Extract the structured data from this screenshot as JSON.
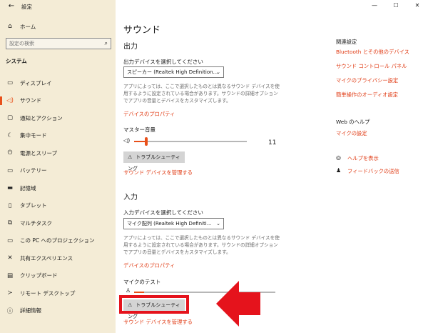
{
  "window": {
    "title": "設定",
    "controls": [
      "—",
      "☐",
      "✕"
    ]
  },
  "sidebar": {
    "home_label": "ホーム",
    "search_placeholder": "設定の検索",
    "section_label": "システム",
    "items": [
      {
        "label": "ディスプレイ",
        "icon": "monitor-icon",
        "glyph": "▭"
      },
      {
        "label": "サウンド",
        "icon": "speaker-icon",
        "glyph": "◁)",
        "active": true
      },
      {
        "label": "通知とアクション",
        "icon": "notification-icon",
        "glyph": "▢"
      },
      {
        "label": "集中モード",
        "icon": "moon-icon",
        "glyph": "☾"
      },
      {
        "label": "電源とスリープ",
        "icon": "power-icon",
        "glyph": "⏻"
      },
      {
        "label": "バッテリー",
        "icon": "battery-icon",
        "glyph": "▭"
      },
      {
        "label": "記憶域",
        "icon": "storage-icon",
        "glyph": "▬"
      },
      {
        "label": "タブレット",
        "icon": "tablet-icon",
        "glyph": "▯"
      },
      {
        "label": "マルチタスク",
        "icon": "multitask-icon",
        "glyph": "⧉"
      },
      {
        "label": "この PC へのプロジェクション",
        "icon": "projection-icon",
        "glyph": "▭"
      },
      {
        "label": "共有エクスペリエンス",
        "icon": "shared-icon",
        "glyph": "✕"
      },
      {
        "label": "クリップボード",
        "icon": "clipboard-icon",
        "glyph": "▤"
      },
      {
        "label": "リモート デスクトップ",
        "icon": "remote-desktop-icon",
        "glyph": "≻"
      },
      {
        "label": "詳細情報",
        "icon": "info-icon",
        "glyph": "ⓘ"
      }
    ]
  },
  "main": {
    "title": "サウンド",
    "output": {
      "heading": "出力",
      "select_label": "出力デバイスを選択してください",
      "device": "スピーカー (Realtek High Definition...",
      "description": "アプリによっては、ここで選択したものとは異なるサウンド デバイスを使用するように設定されている場合があります。サウンドの詳細オプションでアプリの音量とデバイスをカスタマイズします。",
      "properties_link": "デバイスのプロパティ",
      "master_volume_label": "マスター音量",
      "volume_value": "11",
      "volume_level": 0.11,
      "troubleshoot_label": "トラブルシューティング",
      "manage_link": "サウンド デバイスを管理する"
    },
    "input": {
      "heading": "入力",
      "select_label": "入力デバイスを選択してください",
      "device": "マイク配列 (Realtek High Definiti...",
      "description": "アプリによっては、ここで選択したものとは異なるサウンド デバイスを使用するように設定されている場合があります。サウンドの詳細オプションでアプリの音量とデバイスをカスタマイズします。",
      "properties_link": "デバイスのプロパティ",
      "mic_test_label": "マイクのテスト",
      "mic_level": 0.07,
      "troubleshoot_label": "トラブルシューティング",
      "manage_link": "サウンド デバイスを管理する"
    }
  },
  "related": {
    "heading": "関連設定",
    "links": [
      "Bluetooth とその他のデバイス",
      "サウンド コントロール パネル",
      "マイクのプライバシー設定",
      "簡単操作のオーディオ設定"
    ],
    "web_help_heading": "Web のヘルプ",
    "web_help_link": "マイクの設定",
    "help_link": "ヘルプを表示",
    "feedback_link": "フィードバックの送信"
  },
  "colors": {
    "accent": "#e8501a",
    "link": "#e03b14",
    "sidebar_bg": "#f4ecd6",
    "annotation_red": "#e5131c"
  }
}
